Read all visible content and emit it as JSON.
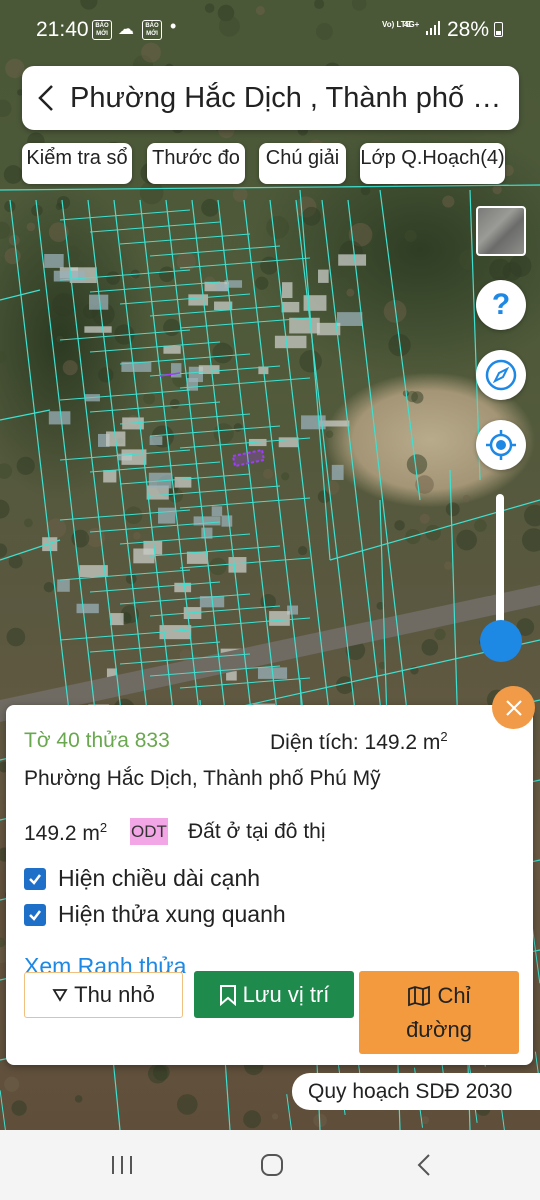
{
  "status_bar": {
    "time": "21:40",
    "badge_text": "BÁO MỚI",
    "volte": "Vo) LTE",
    "network": "4G+",
    "battery": "28%"
  },
  "search": {
    "title": "Phường Hắc Dịch , Thành phố Phú Mỹ"
  },
  "chips": {
    "check": "Kiểm tra sổ",
    "ruler": "Thước đo",
    "legend": "Chú giải",
    "layer": "Lớp Q.Hoạch(4)"
  },
  "controls": {
    "help": "?"
  },
  "parcel": {
    "id_label": "Tờ 40 thửa 833",
    "area_label": "Diện tích: 149.2 m",
    "area_sup": "2",
    "address": "Phường Hắc Dịch, Thành phố Phú Mỹ",
    "area_value": "149.2 m",
    "area_value_sup": "2",
    "land_code": "ODT",
    "land_code_color": "#f3a6e6",
    "land_type": "Đất ở tại đô thị"
  },
  "options": {
    "show_edge_length": "Hiện chiều dài cạnh",
    "show_edge_length_checked": true,
    "show_surrounding": "Hiện thửa xung quanh",
    "show_surrounding_checked": true
  },
  "actions": {
    "view_boundary": "Xem Ranh thửa",
    "collapse": "Thu nhỏ",
    "save_location": "Lưu vị trí",
    "route_line1": "Chỉ",
    "route_line2": "đường"
  },
  "plan_label": "Quy hoạch SDĐ 2030",
  "colors": {
    "accent_blue": "#1e88e5",
    "save_green": "#1e8a4c",
    "route_orange": "#f39a3f",
    "parcel_green": "#6aa84f",
    "parcel_lines": "#3fe0d0",
    "selected_parcel": "#a03cff"
  }
}
